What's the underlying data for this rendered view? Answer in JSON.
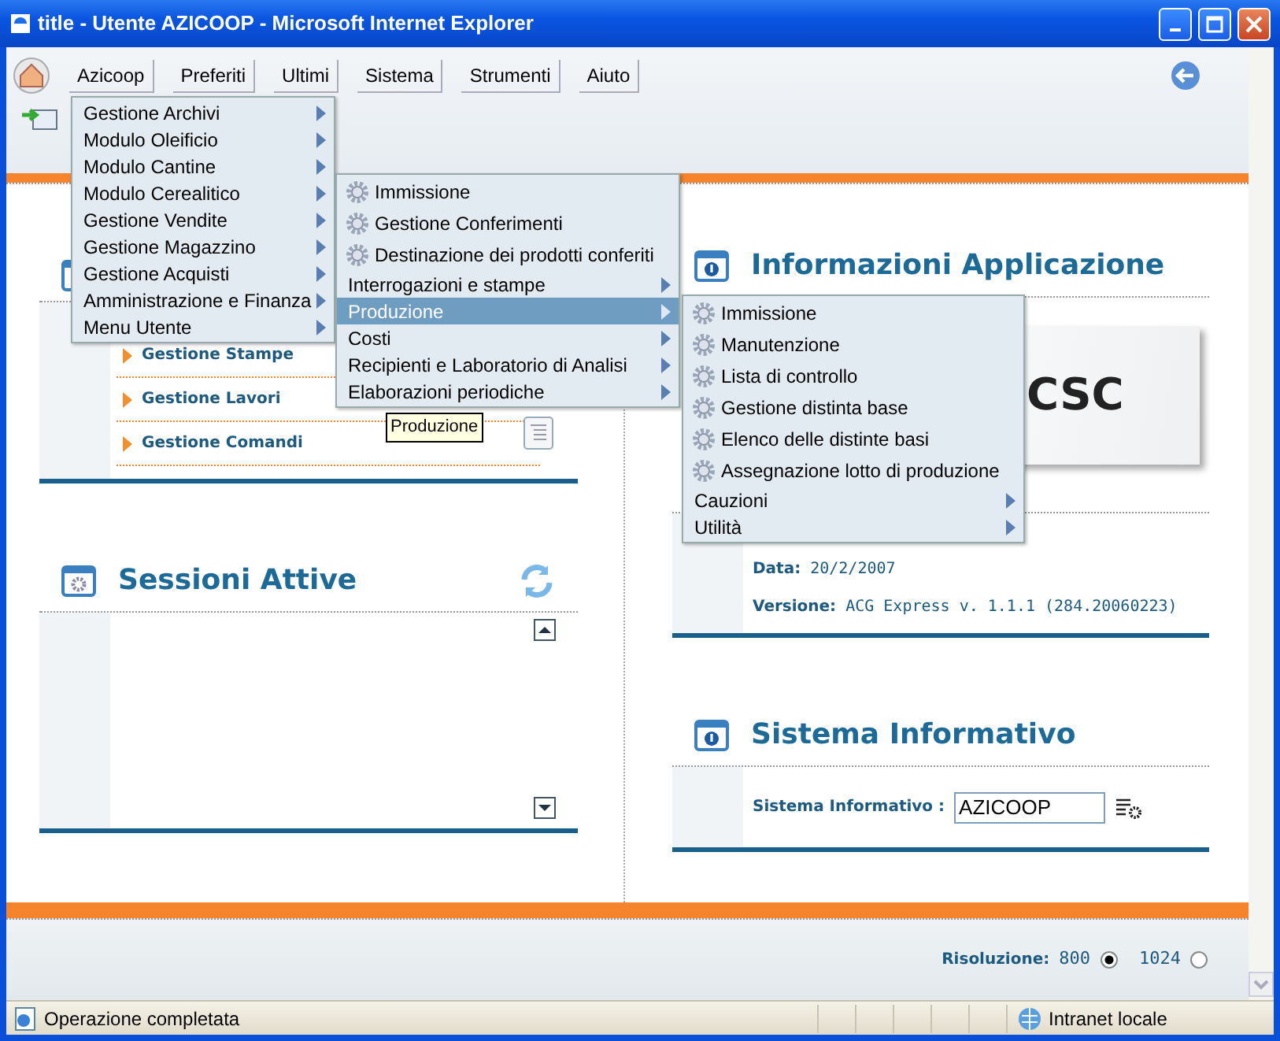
{
  "window": {
    "title": "title - Utente AZICOOP - Microsoft Internet Explorer"
  },
  "menu_bar": [
    "Azicoop",
    "Preferiti",
    "Ultimi",
    "Sistema",
    "Strumenti",
    "Aiuto"
  ],
  "menus": [
    {
      "items": [
        {
          "label": "Gestione Archivi",
          "kind": "submenu",
          "selected": false
        },
        {
          "label": "Modulo Oleificio",
          "kind": "submenu",
          "selected": false
        },
        {
          "label": "Modulo Cantine",
          "kind": "submenu",
          "selected": false
        },
        {
          "label": "Modulo Cerealitico",
          "kind": "submenu",
          "selected": false
        },
        {
          "label": "Gestione Vendite",
          "kind": "submenu",
          "selected": false
        },
        {
          "label": "Gestione Magazzino",
          "kind": "submenu",
          "selected": false
        },
        {
          "label": "Gestione Acquisti",
          "kind": "submenu",
          "selected": false
        },
        {
          "label": "Amministrazione e Finanza",
          "kind": "submenu",
          "selected": false
        },
        {
          "label": "Menu Utente",
          "kind": "submenu",
          "selected": false
        }
      ]
    },
    {
      "items": [
        {
          "label": "Immissione",
          "kind": "action",
          "selected": false
        },
        {
          "label": "Gestione Conferimenti",
          "kind": "action",
          "selected": false
        },
        {
          "label": "Destinazione dei prodotti conferiti",
          "kind": "action",
          "selected": false
        },
        {
          "label": "Interrogazioni e stampe",
          "kind": "submenu",
          "selected": false
        },
        {
          "label": "Produzione",
          "kind": "submenu",
          "selected": true
        },
        {
          "label": "Costi",
          "kind": "submenu",
          "selected": false
        },
        {
          "label": "Recipienti e Laboratorio di Analisi",
          "kind": "submenu",
          "selected": false
        },
        {
          "label": "Elaborazioni periodiche",
          "kind": "submenu",
          "selected": false
        }
      ]
    },
    {
      "items": [
        {
          "label": "Immissione",
          "kind": "action",
          "selected": false
        },
        {
          "label": "Manutenzione",
          "kind": "action",
          "selected": false
        },
        {
          "label": "Lista di controllo",
          "kind": "action",
          "selected": false
        },
        {
          "label": "Gestione distinta base",
          "kind": "action",
          "selected": false
        },
        {
          "label": "Elenco delle distinte basi",
          "kind": "action",
          "selected": false
        },
        {
          "label": "Assegnazione lotto di produzione",
          "kind": "action",
          "selected": false
        },
        {
          "label": "Cauzioni",
          "kind": "submenu",
          "selected": false
        },
        {
          "label": "Utilità",
          "kind": "submenu",
          "selected": false
        }
      ]
    }
  ],
  "tooltip": "Produzione",
  "tools_panel": {
    "links": [
      "Gestione Stampe",
      "Gestione Lavori",
      "Gestione Comandi"
    ]
  },
  "sessions_panel": {
    "title": "Sessioni Attive"
  },
  "info_panel": {
    "title": "Informazioni Applicazione",
    "logo": "CSC",
    "fields": [
      {
        "label": "Data:",
        "value": "20/2/2007"
      },
      {
        "label": "Versione:",
        "value": "ACG Express v. 1.1.1 (284.20060223)"
      }
    ]
  },
  "system_panel": {
    "title": "Sistema Informativo",
    "label": "Sistema Informativo :",
    "value": "AZICOOP"
  },
  "footer": {
    "label": "Risoluzione:",
    "options": [
      {
        "label": "800",
        "selected": true
      },
      {
        "label": "1024",
        "selected": false
      }
    ]
  },
  "status_bar": {
    "text": "Operazione completata",
    "zone": "Intranet locale"
  }
}
